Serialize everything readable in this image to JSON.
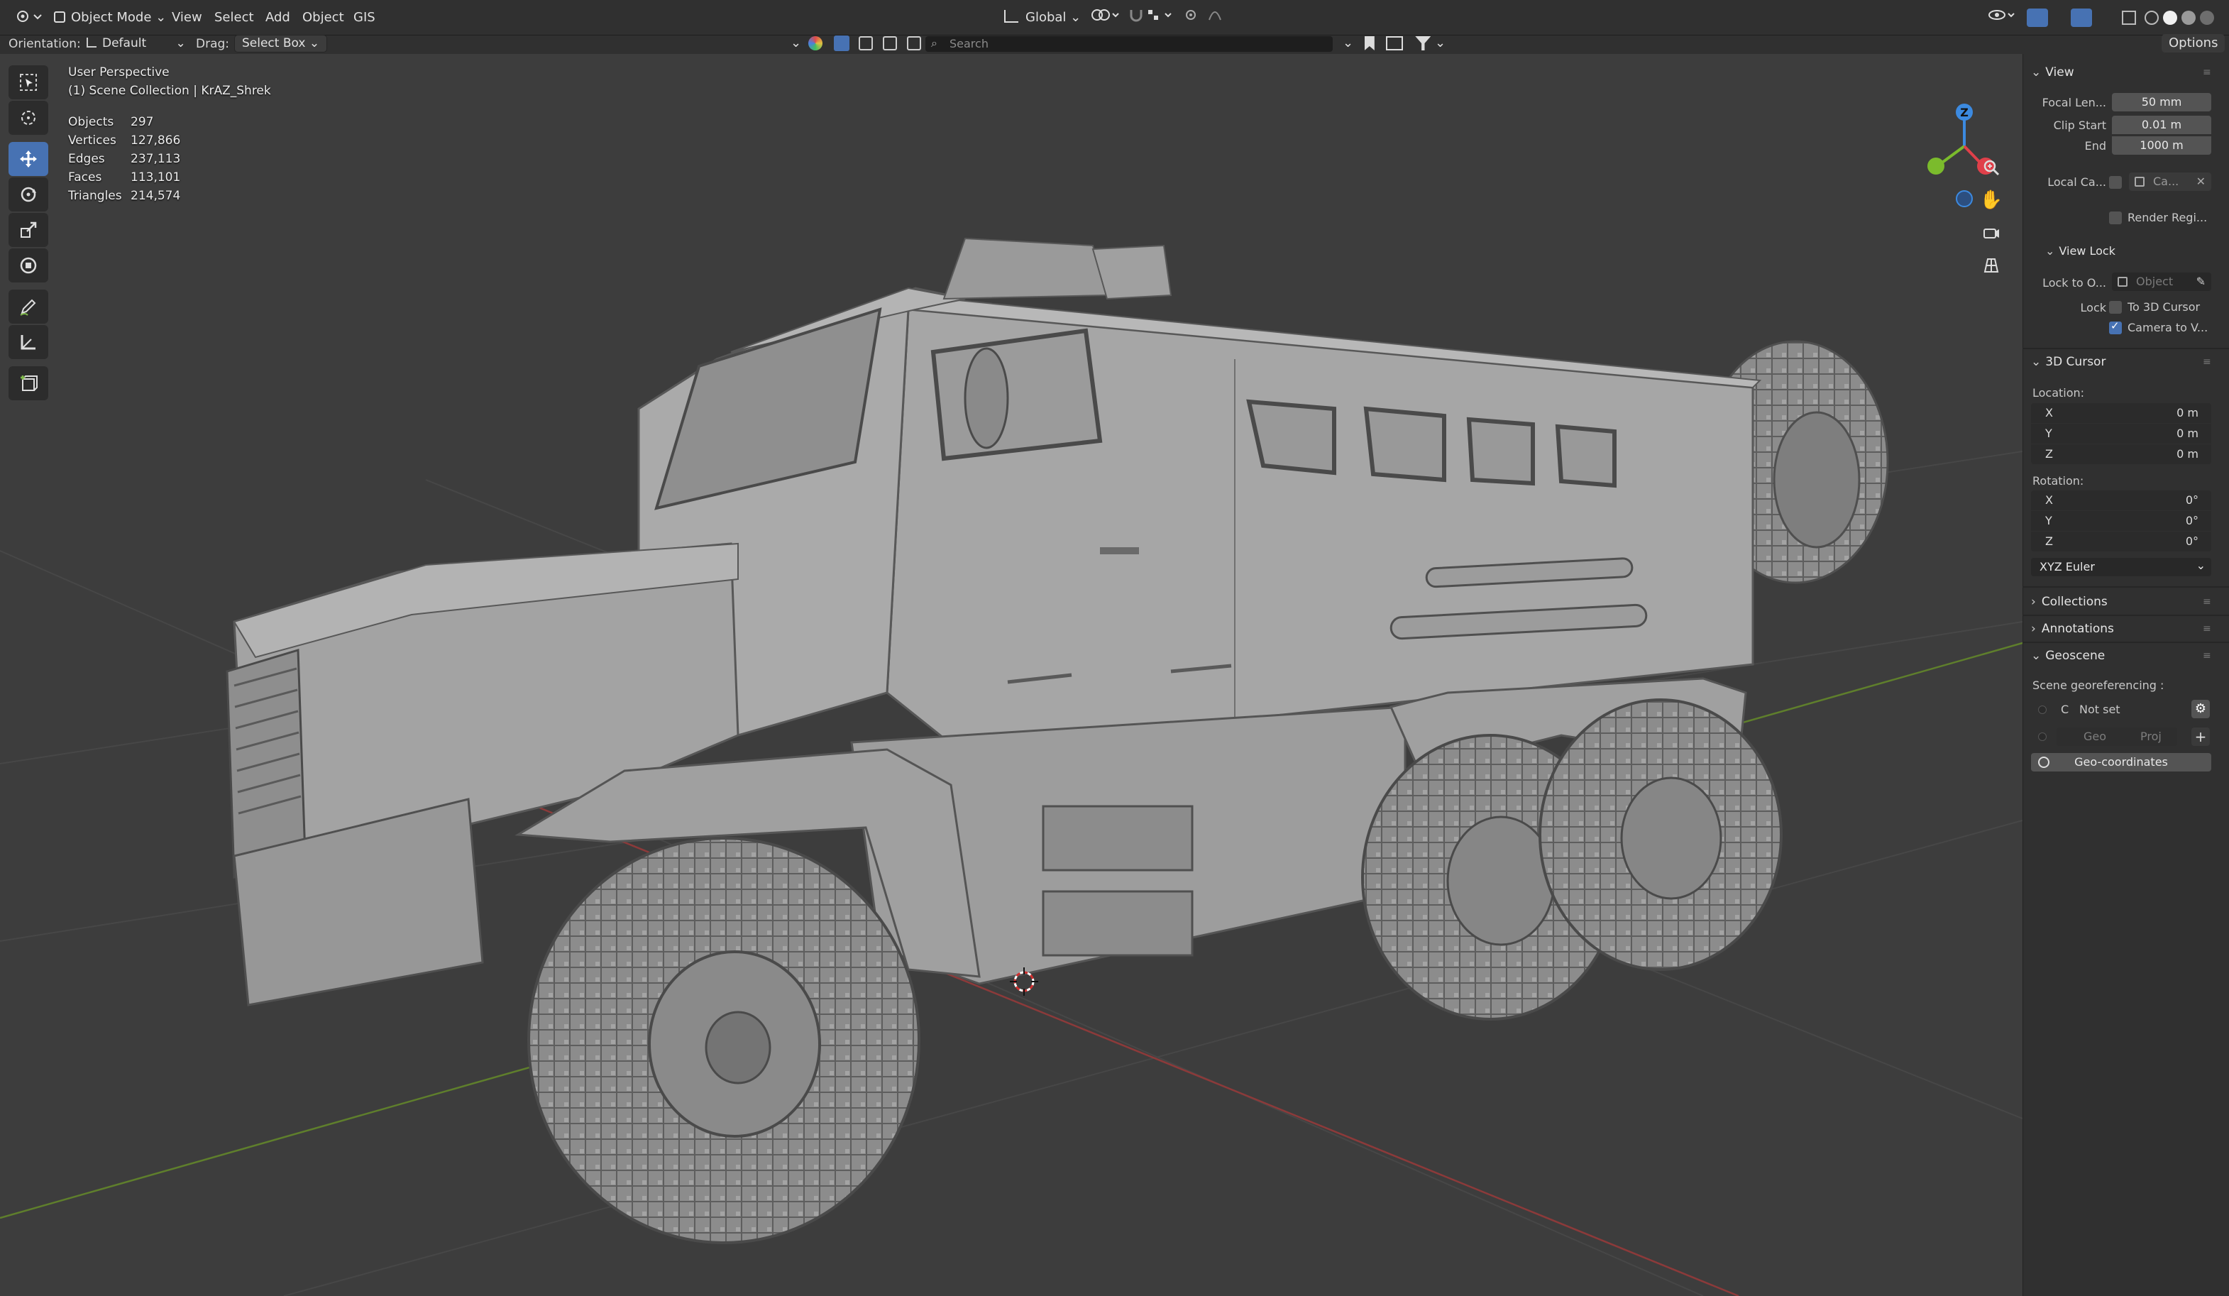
{
  "header": {
    "mode": "Object Mode",
    "menus": [
      "View",
      "Select",
      "Add",
      "Object",
      "GIS"
    ],
    "transform_orientation": "Global",
    "orientation_label": "Orientation:",
    "orientation_value": "Default",
    "drag_label": "Drag:",
    "drag_value": "Select Box",
    "search_placeholder": "Search",
    "options_label": "Options"
  },
  "viewport": {
    "view_name": "User Perspective",
    "collection_line": "(1) Scene Collection | KrAZ_Shrek",
    "stats": [
      {
        "label": "Objects",
        "value": "297"
      },
      {
        "label": "Vertices",
        "value": "127,866"
      },
      {
        "label": "Edges",
        "value": "237,113"
      },
      {
        "label": "Faces",
        "value": "113,101"
      },
      {
        "label": "Triangles",
        "value": "214,574"
      }
    ],
    "gizmo": {
      "z": "Z",
      "x_color": "#e0404a",
      "y_color": "#7bbb2c",
      "z_color": "#3c8ae0"
    }
  },
  "sidebar": {
    "view_header": "View",
    "focal_label": "Focal Len...",
    "focal_value": "50 mm",
    "clip_start_label": "Clip Start",
    "clip_start_value": "0.01 m",
    "clip_end_label": "End",
    "clip_end_value": "1000 m",
    "local_cam_label": "Local Ca...",
    "local_cam_value": "Ca...",
    "render_region_label": "Render Regi...",
    "view_lock_header": "View Lock",
    "lock_to_label": "Lock to O...",
    "lock_to_placeholder": "Object",
    "lock_label": "Lock",
    "to_3d_cursor": "To 3D Cursor",
    "camera_to_view": "Camera to V...",
    "cursor_header": "3D Cursor",
    "location_label": "Location:",
    "location": [
      {
        "axis": "X",
        "value": "0 m"
      },
      {
        "axis": "Y",
        "value": "0 m"
      },
      {
        "axis": "Z",
        "value": "0 m"
      }
    ],
    "rotation_label": "Rotation:",
    "rotation": [
      {
        "axis": "X",
        "value": "0°"
      },
      {
        "axis": "Y",
        "value": "0°"
      },
      {
        "axis": "Z",
        "value": "0°"
      }
    ],
    "rotation_mode": "XYZ Euler",
    "collections_header": "Collections",
    "annotations_header": "Annotations",
    "geoscene_header": "Geoscene",
    "georef_label": "Scene georeferencing :",
    "crs_prefix": "C",
    "crs_value": "Not set",
    "geo_btn": "Geo",
    "proj_btn": "Proj",
    "geo_coords_btn": "Geo-coordinates"
  }
}
